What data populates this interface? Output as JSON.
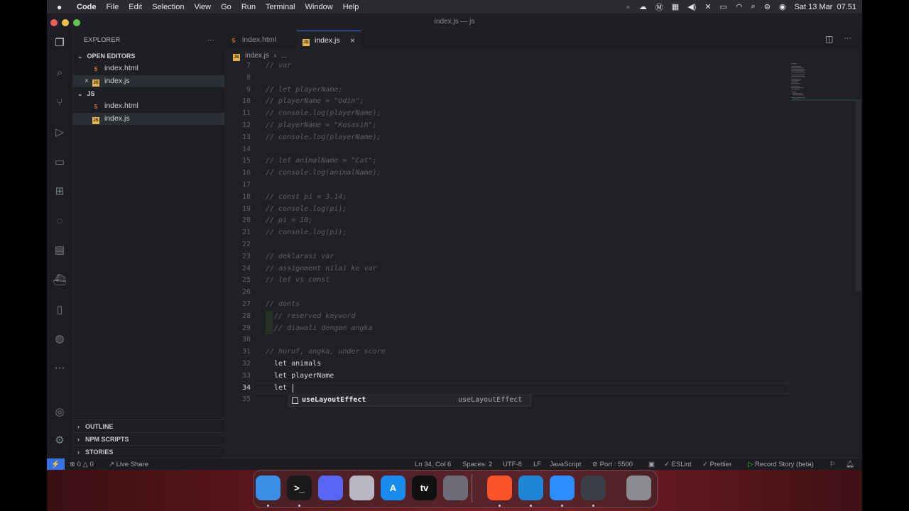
{
  "menubar": {
    "app": "Code",
    "items": [
      "File",
      "Edit",
      "Selection",
      "View",
      "Go",
      "Run",
      "Terminal",
      "Window",
      "Help"
    ],
    "clock": "Sat 13 Mar  07.51"
  },
  "window": {
    "title": "index.js — js"
  },
  "sidebar": {
    "header": "EXPLORER",
    "more": "···",
    "open_editors_label": "OPEN EDITORS",
    "open_editors": [
      {
        "label": "index.html",
        "icon": "html-file-icon"
      },
      {
        "label": "index.js",
        "icon": "js-file-icon"
      }
    ],
    "folder_label": "JS",
    "folder_files": [
      {
        "label": "index.html",
        "icon": "html-file-icon"
      },
      {
        "label": "index.js",
        "icon": "js-file-icon"
      }
    ],
    "outline": "OUTLINE",
    "npm": "NPM SCRIPTS",
    "stories": "STORIES"
  },
  "tabs": [
    {
      "label": "index.html",
      "active": false
    },
    {
      "label": "index.js",
      "active": true
    }
  ],
  "breadcrumb": {
    "file": "index.js",
    "rest": "..."
  },
  "editor": {
    "lines": [
      {
        "n": "7",
        "t": "// var",
        "k": "cm",
        "indent": 0
      },
      {
        "n": "8",
        "t": "",
        "k": "cm",
        "indent": 0
      },
      {
        "n": "9",
        "t": "// let playerName;",
        "k": "cm",
        "indent": 0
      },
      {
        "n": "10",
        "t": "// playerName = \"Udin\";",
        "k": "cm",
        "indent": 0
      },
      {
        "n": "11",
        "t": "// console.log(playerName);",
        "k": "cm",
        "indent": 0
      },
      {
        "n": "12",
        "t": "// playerName = \"Kosasih\";",
        "k": "cm",
        "indent": 0
      },
      {
        "n": "13",
        "t": "// console.log(playerName);",
        "k": "cm",
        "indent": 0
      },
      {
        "n": "14",
        "t": "",
        "k": "cm",
        "indent": 0
      },
      {
        "n": "15",
        "t": "// let animalName = \"Cat\";",
        "k": "cm",
        "indent": 0
      },
      {
        "n": "16",
        "t": "// console.log(animalName);",
        "k": "cm",
        "indent": 0
      },
      {
        "n": "17",
        "t": "",
        "k": "cm",
        "indent": 0
      },
      {
        "n": "18",
        "t": "// const pi = 3.14;",
        "k": "cm",
        "indent": 0
      },
      {
        "n": "19",
        "t": "// console.log(pi);",
        "k": "cm",
        "indent": 0
      },
      {
        "n": "20",
        "t": "// pi = 10;",
        "k": "cm",
        "indent": 0
      },
      {
        "n": "21",
        "t": "// console.log(pi);",
        "k": "cm",
        "indent": 0
      },
      {
        "n": "22",
        "t": "",
        "k": "cm",
        "indent": 0
      },
      {
        "n": "23",
        "t": "// deklarasi var",
        "k": "cm",
        "indent": 0
      },
      {
        "n": "24",
        "t": "// assignment nilai ke var",
        "k": "cm",
        "indent": 0
      },
      {
        "n": "25",
        "t": "// let vs const",
        "k": "cm",
        "indent": 0
      },
      {
        "n": "26",
        "t": "",
        "k": "cm",
        "indent": 0
      },
      {
        "n": "27",
        "t": "// donts",
        "k": "cm",
        "indent": 0
      },
      {
        "n": "28",
        "t": "// reserved keyword",
        "k": "cm",
        "indent": 1
      },
      {
        "n": "29",
        "t": "// diawali dengan angka",
        "k": "cm",
        "indent": 1
      },
      {
        "n": "30",
        "t": "",
        "k": "cm",
        "indent": 0
      },
      {
        "n": "31",
        "t": "// huruf, angka, under score",
        "k": "cm",
        "indent": 0
      },
      {
        "n": "32",
        "t": "let animals",
        "k": "kw",
        "indent": 1
      },
      {
        "n": "33",
        "t": "let playerName",
        "k": "kw",
        "indent": 1
      },
      {
        "n": "34",
        "t": "let",
        "k": "kw",
        "indent": 1
      },
      {
        "n": "35",
        "t": "",
        "k": "kw",
        "indent": 0
      }
    ],
    "current_line": "34",
    "suggestion": {
      "label": "useLayoutEffect",
      "detail": "useLayoutEffect"
    }
  },
  "status": {
    "errors": "0",
    "warnings": "0",
    "live_share": "Live Share",
    "position": "Ln 34, Col 6",
    "spaces": "Spaces: 2",
    "encoding": "UTF-8",
    "eol": "LF",
    "language": "JavaScript",
    "port": "Port : 5500",
    "eslint": "ESLint",
    "prettier": "Prettier",
    "record": "Record Story (beta)"
  },
  "dock": [
    {
      "name": "finder-icon",
      "color": "#3a8ee6",
      "glyph": ""
    },
    {
      "name": "terminal-icon",
      "color": "#1a1a1a",
      "glyph": ">_"
    },
    {
      "name": "discord-icon",
      "color": "#5865f2",
      "glyph": ""
    },
    {
      "name": "launchpad-icon",
      "color": "#b8b8c4",
      "glyph": ""
    },
    {
      "name": "app-store-icon",
      "color": "#1a8cf0",
      "glyph": "A"
    },
    {
      "name": "apple-tv-icon",
      "color": "#111111",
      "glyph": "tv"
    },
    {
      "name": "preview-app-icon",
      "color": "#6c6c78",
      "glyph": ""
    },
    {
      "name": "brave-icon",
      "color": "#fb542b",
      "glyph": ""
    },
    {
      "name": "vscode-icon",
      "color": "#1e86d4",
      "glyph": ""
    },
    {
      "name": "zoom-icon",
      "color": "#2d8cff",
      "glyph": ""
    },
    {
      "name": "quicktime-icon",
      "color": "#3a3d45",
      "glyph": ""
    },
    {
      "name": "trash-icon",
      "color": "#8a8c92",
      "glyph": ""
    }
  ]
}
